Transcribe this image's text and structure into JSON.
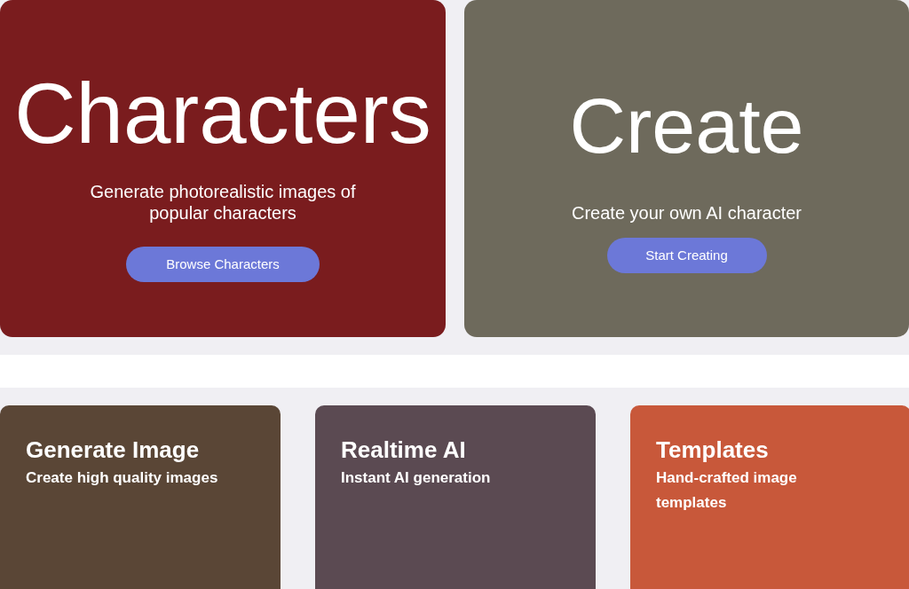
{
  "hero_cards": [
    {
      "title": "Characters",
      "subtitle": "Generate photorealistic images of popular characters",
      "button": "Browse Characters",
      "color": "#7a1c1e"
    },
    {
      "title": "Create",
      "subtitle": "Create your own AI character",
      "button": "Start Creating",
      "color": "#6e6a5c"
    }
  ],
  "feature_cards": [
    {
      "title": "Generate Image",
      "subtitle": "Create high quality images",
      "color": "#5a4636"
    },
    {
      "title": "Realtime AI",
      "subtitle": "Instant AI generation",
      "color": "#5b4a52"
    },
    {
      "title": "Templates",
      "subtitle": "Hand-crafted image templates",
      "color": "#c8583a"
    }
  ]
}
